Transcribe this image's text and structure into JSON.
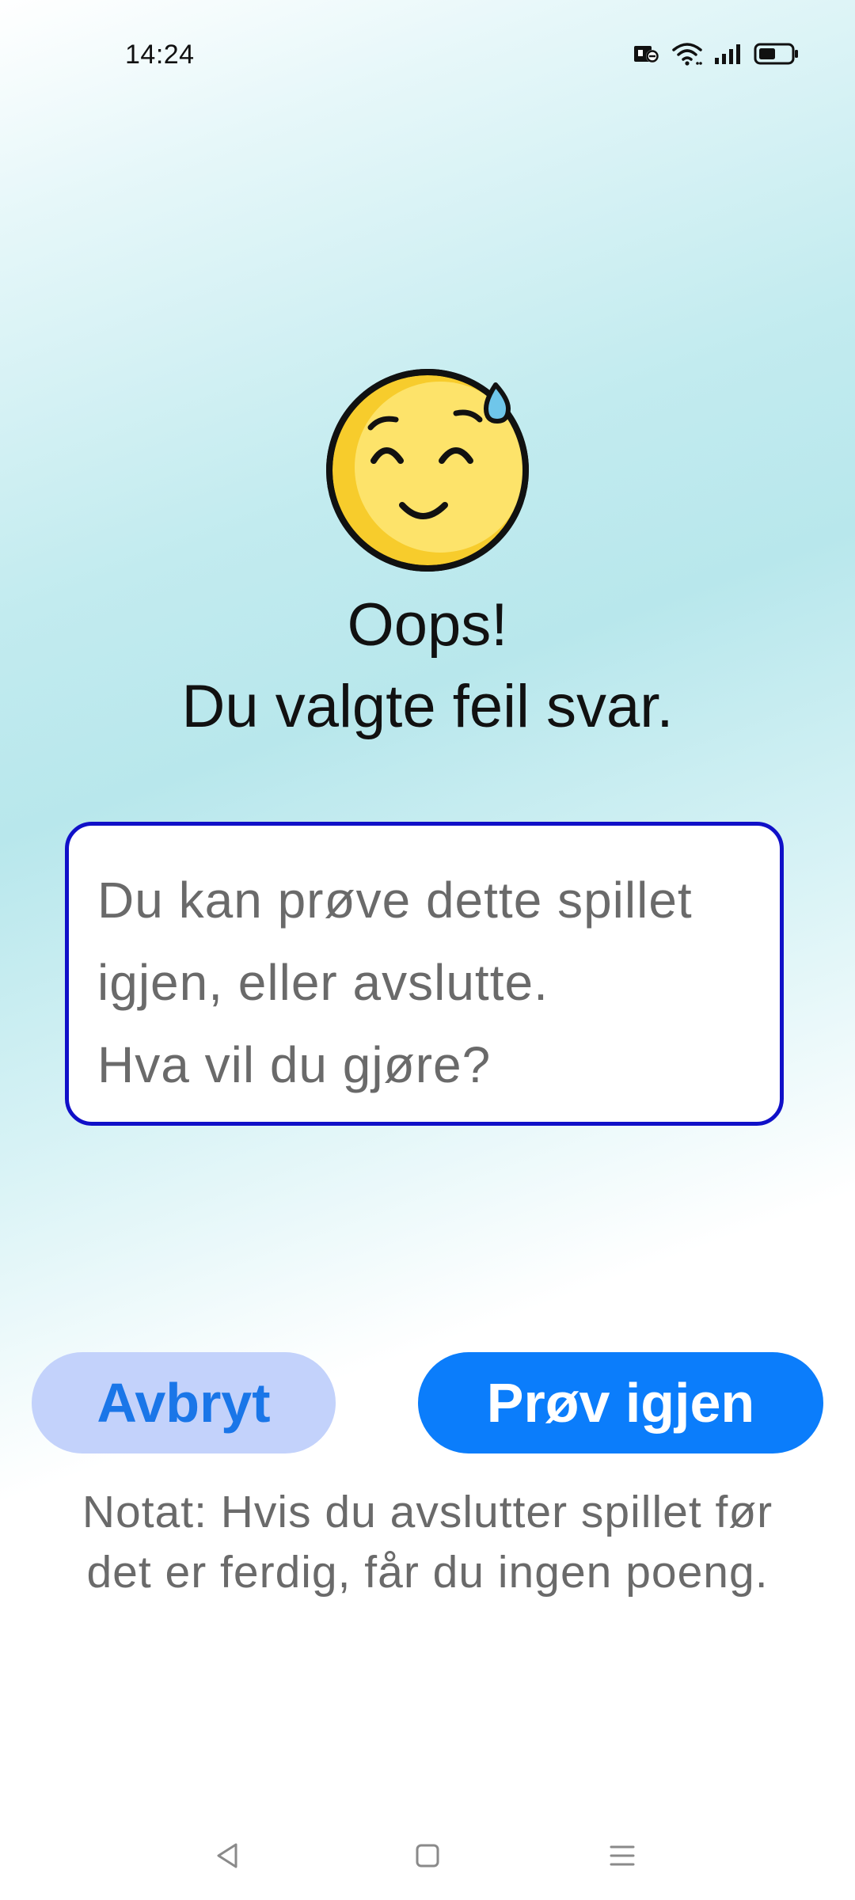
{
  "status_bar": {
    "time": "14:24",
    "icons": [
      "nfc-icon",
      "wifi-icon",
      "signal-icon",
      "battery-icon"
    ]
  },
  "emoji": "grinning-sweat-emoji",
  "dialog": {
    "title_line1": "Oops!",
    "title_line2": "Du valgte feil svar.",
    "message_lines": [
      "Du kan prøve dette spillet",
      "igjen, eller avslutte.",
      "Hva vil du gjøre?"
    ]
  },
  "buttons": {
    "cancel_label": "Avbryt",
    "retry_label": "Prøv igjen"
  },
  "note": {
    "line1": "Notat: Hvis du avslutter spillet før",
    "line2": "det er ferdig, får du ingen poeng."
  },
  "nav_bar": {
    "icons": [
      "back-icon",
      "home-icon",
      "menu-icon"
    ]
  },
  "colors": {
    "accent_blue": "#0b7dfb",
    "cancel_bg": "#c3d2fb",
    "box_border": "#1010c8",
    "text_gray": "#6a6a6a"
  }
}
